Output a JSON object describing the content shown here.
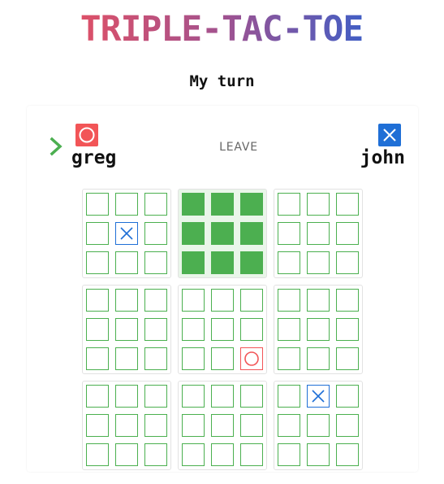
{
  "title": "TRIPLE-TAC-TOE",
  "status": "My turn",
  "players": {
    "left": {
      "name": "greg",
      "mark": "O",
      "color": "#f25557",
      "active": true
    },
    "right": {
      "name": "john",
      "mark": "X",
      "color": "#1f6fd6",
      "active": false
    }
  },
  "leave_label": "LEAVE",
  "colors": {
    "grid": "#4bb04f",
    "won": "#4caf50",
    "o": "#f25557",
    "x": "#1f6fd6"
  },
  "board": [
    [
      "",
      "",
      "",
      "",
      "X",
      "",
      "",
      "",
      ""
    ],
    [
      "won",
      "won",
      "won",
      "won",
      "won",
      "won",
      "won",
      "won",
      "won"
    ],
    [
      "",
      "",
      "",
      "",
      "",
      "",
      "",
      "",
      ""
    ],
    [
      "",
      "",
      "",
      "",
      "",
      "",
      "",
      "",
      ""
    ],
    [
      "",
      "",
      "",
      "",
      "",
      "",
      "",
      "",
      "O"
    ],
    [
      "",
      "",
      "",
      "",
      "",
      "",
      "",
      "",
      ""
    ],
    [
      "",
      "",
      "",
      "",
      "",
      "",
      "",
      "",
      ""
    ],
    [
      "",
      "",
      "",
      "",
      "",
      "",
      "",
      "",
      ""
    ],
    [
      "",
      "X",
      "",
      "",
      "",
      "",
      "",
      "",
      ""
    ]
  ],
  "won_boards": [
    1
  ]
}
